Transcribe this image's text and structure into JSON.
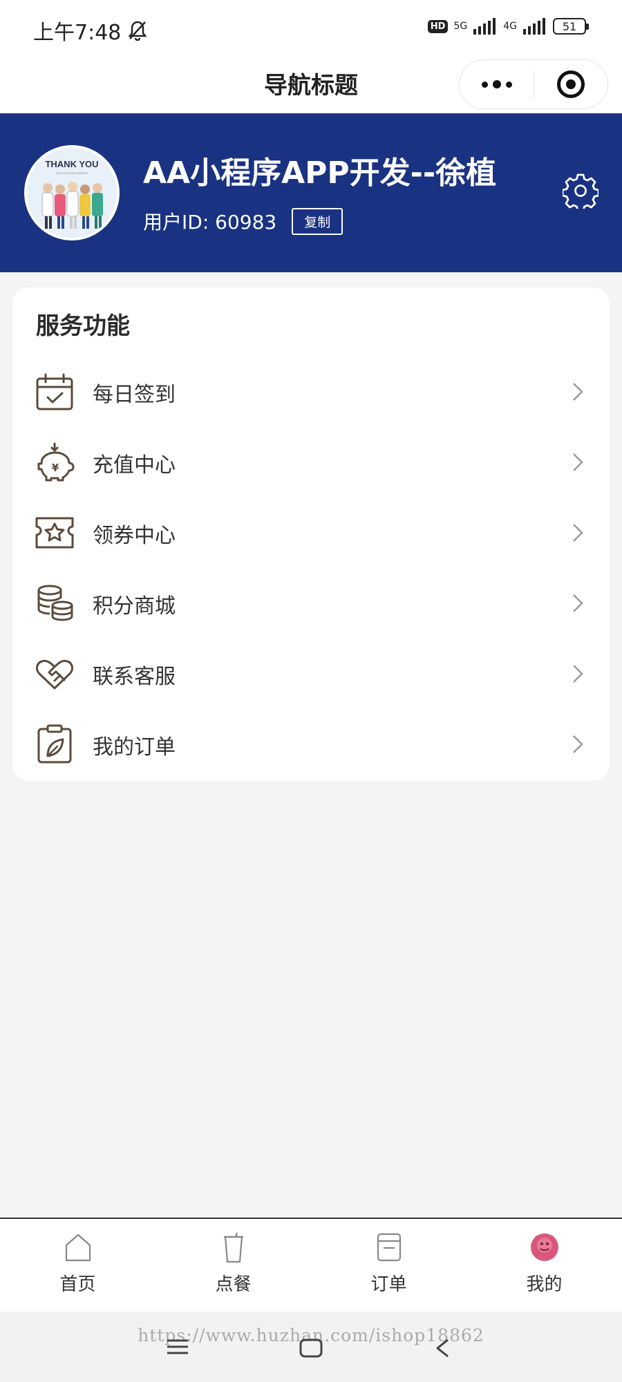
{
  "status_bar": {
    "time": "上午7:48",
    "hd": "HD",
    "network_1": "5G",
    "network_2": "4G",
    "battery": "51"
  },
  "nav": {
    "title": "导航标题"
  },
  "profile": {
    "name": "AA小程序APP开发--徐植",
    "user_id": "用户ID: 60983",
    "copy_label": "复制",
    "avatar_text": "THANK YOU",
    "avatar_subtext": "DOCTORS AND NURSES"
  },
  "services": {
    "title": "服务功能",
    "items": [
      {
        "label": "每日签到",
        "icon": "calendar-check-icon"
      },
      {
        "label": "充值中心",
        "icon": "piggy-bank-icon"
      },
      {
        "label": "领券中心",
        "icon": "coupon-icon"
      },
      {
        "label": "积分商城",
        "icon": "coins-icon"
      },
      {
        "label": "联系客服",
        "icon": "heart-handshake-icon"
      },
      {
        "label": "我的订单",
        "icon": "clipboard-leaf-icon"
      }
    ]
  },
  "tabs": [
    {
      "label": "首页",
      "icon": "home-icon"
    },
    {
      "label": "点餐",
      "icon": "cup-icon"
    },
    {
      "label": "订单",
      "icon": "order-icon"
    },
    {
      "label": "我的",
      "icon": "profile-icon",
      "active": true
    }
  ],
  "watermark": "https://www.huzhan.com/ishop18862",
  "colors": {
    "header_bg": "#1a3282",
    "icon_color": "#5c4a3a",
    "accent_pink": "#d9577b"
  }
}
